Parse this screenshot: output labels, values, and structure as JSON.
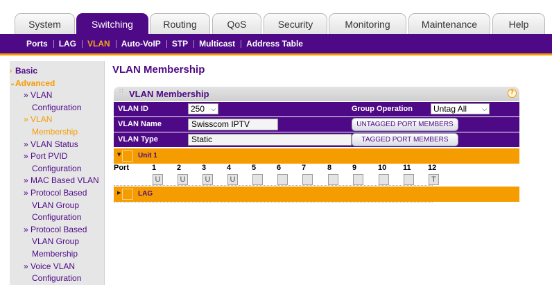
{
  "top_tabs": [
    "System",
    "Switching",
    "Routing",
    "QoS",
    "Security",
    "Monitoring",
    "Maintenance",
    "Help"
  ],
  "active_top_tab": "Switching",
  "sub_nav": [
    "Ports",
    "LAG",
    "VLAN",
    "Auto-VoIP",
    "STP",
    "Multicast",
    "Address Table"
  ],
  "active_sub_nav": "VLAN",
  "sidebar": {
    "basic": "Basic",
    "advanced": "Advanced",
    "items": [
      {
        "l1": "» VLAN",
        "l2": "Configuration"
      },
      {
        "l1": "» VLAN",
        "l2": "Membership"
      },
      {
        "l1": "» VLAN Status",
        "l2": ""
      },
      {
        "l1": "» Port PVID",
        "l2": "Configuration"
      },
      {
        "l1": "» MAC Based VLAN",
        "l2": ""
      },
      {
        "l1": "» Protocol Based",
        "l2": "VLAN Group",
        "l3": "Configuration"
      },
      {
        "l1": "» Protocol Based",
        "l2": "VLAN Group",
        "l3": "Membership"
      },
      {
        "l1": "» Voice VLAN",
        "l2": "Configuration"
      }
    ]
  },
  "page_title": "VLAN Membership",
  "panel": {
    "title": "VLAN Membership",
    "help": "?",
    "vlan_id_label": "VLAN ID",
    "vlan_id_value": "250",
    "group_operation_label": "Group Operation",
    "group_operation_value": "Untag All",
    "vlan_name_label": "VLAN Name",
    "vlan_name_value": "Swisscom IPTV",
    "untagged_button": "UNTAGGED PORT MEMBERS",
    "vlan_type_label": "VLAN Type",
    "vlan_type_value": "Static",
    "tagged_button": "TAGGED PORT MEMBERS"
  },
  "unit_label": "Unit 1",
  "port_label": "Port",
  "ports": [
    {
      "n": "1",
      "v": "U"
    },
    {
      "n": "2",
      "v": "U"
    },
    {
      "n": "3",
      "v": "U"
    },
    {
      "n": "4",
      "v": "U"
    },
    {
      "n": "5",
      "v": ""
    },
    {
      "n": "6",
      "v": ""
    },
    {
      "n": "7",
      "v": ""
    },
    {
      "n": "8",
      "v": ""
    },
    {
      "n": "9",
      "v": ""
    },
    {
      "n": "10",
      "v": ""
    },
    {
      "n": "11",
      "v": ""
    },
    {
      "n": "12",
      "v": "T"
    }
  ],
  "lag_label": "LAG",
  "colors": {
    "brand_purple": "#4e0a86",
    "accent_orange": "#f59c00"
  }
}
